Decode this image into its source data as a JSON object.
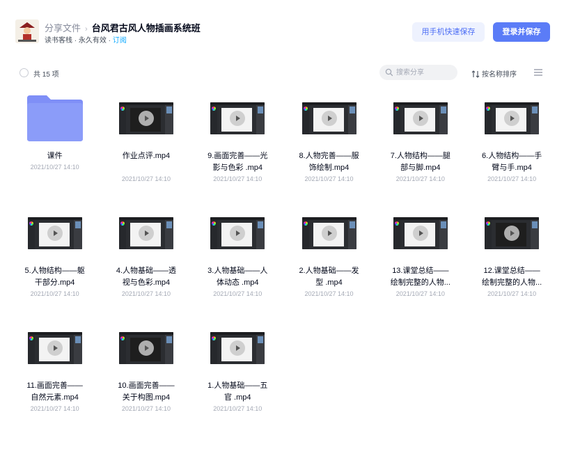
{
  "header": {
    "breadcrumb_parent": "分享文件",
    "breadcrumb_separator": "›",
    "title": "台风君古风人物插画系统班",
    "sub_info": "读书客栈 · 永久有效 · ",
    "subscribe": "订阅",
    "btn_phone": "用手机快速保存",
    "btn_login": "登录并保存"
  },
  "toolbar": {
    "count": "共 15 项",
    "search_placeholder": "搜索分享",
    "sort_label": "按名称排序"
  },
  "files": [
    {
      "name": "课件",
      "date": "2021/10/27 14:10",
      "type": "folder",
      "canvas": "none"
    },
    {
      "name": "作业点评.mp4",
      "date": "2021/10/27 14:10",
      "type": "video",
      "canvas": "dark"
    },
    {
      "name": "9.画面完善——光影与色彩 .mp4",
      "date": "2021/10/27 14:10",
      "type": "video",
      "canvas": "light"
    },
    {
      "name": "8.人物完善——服饰绘制.mp4",
      "date": "2021/10/27 14:10",
      "type": "video",
      "canvas": "light"
    },
    {
      "name": "7.人物结构——腿部与脚.mp4",
      "date": "2021/10/27 14:10",
      "type": "video",
      "canvas": "light"
    },
    {
      "name": "6.人物结构——手臂与手.mp4",
      "date": "2021/10/27 14:10",
      "type": "video",
      "canvas": "light"
    },
    {
      "name": "5.人物结构——躯干部分.mp4",
      "date": "2021/10/27 14:10",
      "type": "video",
      "canvas": "light"
    },
    {
      "name": "4.人物基础——透视与色彩.mp4",
      "date": "2021/10/27 14:10",
      "type": "video",
      "canvas": "light"
    },
    {
      "name": "3.人物基础——人体动态 .mp4",
      "date": "2021/10/27 14:10",
      "type": "video",
      "canvas": "light"
    },
    {
      "name": "2.人物基础——发型 .mp4",
      "date": "2021/10/27 14:10",
      "type": "video",
      "canvas": "light"
    },
    {
      "name": "13.课堂总结——绘制完整的人物...",
      "date": "2021/10/27 14:10",
      "type": "video",
      "canvas": "light"
    },
    {
      "name": "12.课堂总结——绘制完整的人物...",
      "date": "2021/10/27 14:10",
      "type": "video",
      "canvas": "dark"
    },
    {
      "name": "11.画面完善——自然元素.mp4",
      "date": "2021/10/27 14:10",
      "type": "video",
      "canvas": "light"
    },
    {
      "name": "10.画面完善——关于构图.mp4",
      "date": "2021/10/27 14:10",
      "type": "video",
      "canvas": "dark"
    },
    {
      "name": "1.人物基础——五官 .mp4",
      "date": "2021/10/27 14:10",
      "type": "video",
      "canvas": "light"
    }
  ],
  "colors": {
    "accent": "#5b7cf7",
    "link": "#06a7ff",
    "folder": "#8b9cf9"
  }
}
